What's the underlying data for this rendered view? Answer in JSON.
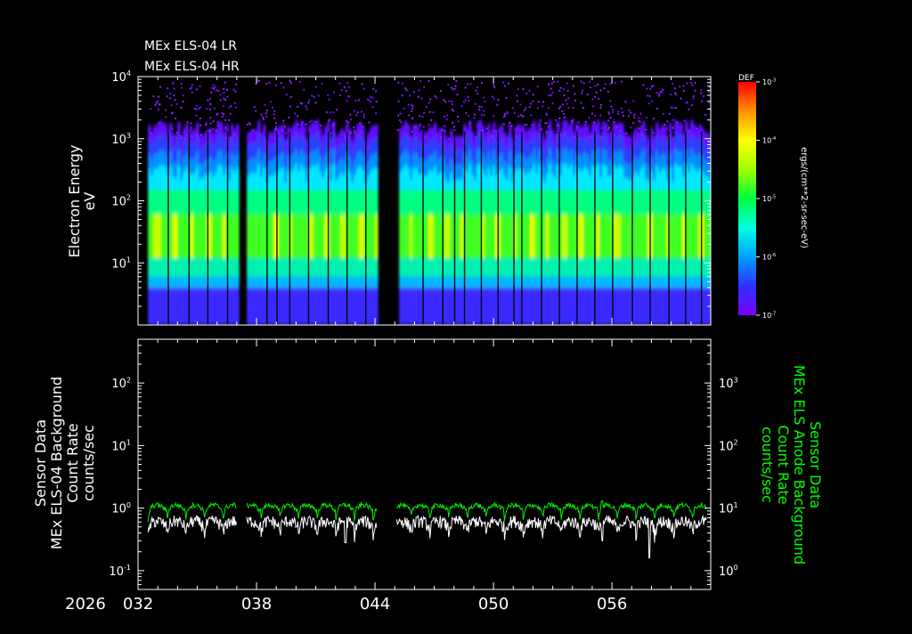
{
  "chart_data": [
    {
      "type": "heatmap",
      "title_lines": [
        "MEx ELS-04 LR",
        "MEx ELS-04 HR"
      ],
      "ylabel_lines": [
        "Electron Energy",
        "eV"
      ],
      "y_scale": "log",
      "ylim": [
        1,
        10000
      ],
      "y_ticks": [
        {
          "value": 10,
          "label": "10",
          "exp": "1"
        },
        {
          "value": 100,
          "label": "10",
          "exp": "2"
        },
        {
          "value": 1000,
          "label": "10",
          "exp": "3"
        },
        {
          "value": 10000,
          "label": "10",
          "exp": "4"
        }
      ],
      "x_range_doy": [
        32,
        61
      ],
      "data_gaps_doy": [
        [
          37.0,
          37.5
        ],
        [
          44.1,
          45.1
        ]
      ],
      "orbit_boundaries_doy": [
        33.5,
        34.55,
        35.5,
        36.5,
        38.5,
        39.0,
        39.65,
        40.6,
        41.6,
        42.55,
        43.5,
        44.15,
        46.4,
        47.4,
        48.0,
        48.5,
        49.35,
        50.2,
        51.0,
        51.4,
        52.4,
        53.3,
        54.2,
        55.1,
        56.0,
        57.0,
        57.9,
        58.85,
        59.7,
        60.5
      ],
      "colorbar": {
        "label": "DEF",
        "title": "ergs/(cm**2-sr-sec-eV)",
        "scale": "log",
        "range": [
          1e-07,
          0.001
        ],
        "ticks": [
          {
            "value": 0.001,
            "label": "10",
            "exp": "-3"
          },
          {
            "value": 0.0001,
            "label": "10",
            "exp": "-4"
          },
          {
            "value": 1e-05,
            "label": "10",
            "exp": "-5"
          },
          {
            "value": 1e-06,
            "label": "10",
            "exp": "-6"
          },
          {
            "value": 1e-07,
            "label": "10",
            "exp": "-7"
          }
        ],
        "colors": [
          "#7a00ff",
          "#3030ff",
          "#00a0ff",
          "#00ffe0",
          "#00ff40",
          "#a0ff00",
          "#ffff00",
          "#ff9000",
          "#ff0000"
        ]
      }
    },
    {
      "type": "line",
      "ylabel_left_lines": [
        "Sensor Data",
        "MEx ELS-04 Background",
        "Count Rate",
        "counts/sec"
      ],
      "ylabel_right_lines": [
        "Sensor Data",
        "MEx ELS Anode Background",
        "Count Rate",
        "counts/sec"
      ],
      "y_scale": "log",
      "ylim_left": [
        0.05,
        500
      ],
      "ylim_right": [
        0.5,
        5000
      ],
      "y_ticks_left": [
        {
          "value": 0.1,
          "label": "10",
          "exp": "-1"
        },
        {
          "value": 1,
          "label": "10",
          "exp": "0"
        },
        {
          "value": 10,
          "label": "10",
          "exp": "1"
        },
        {
          "value": 100,
          "label": "10",
          "exp": "2"
        }
      ],
      "y_ticks_right": [
        {
          "value": 1,
          "label": "10",
          "exp": "0"
        },
        {
          "value": 10,
          "label": "10",
          "exp": "1"
        },
        {
          "value": 100,
          "label": "10",
          "exp": "2"
        },
        {
          "value": 1000,
          "label": "10",
          "exp": "3"
        }
      ],
      "x_range_doy": [
        32,
        61
      ],
      "x_ticks": [
        {
          "value": 32,
          "label": "032"
        },
        {
          "value": 38,
          "label": "038"
        },
        {
          "value": 44,
          "label": "044"
        },
        {
          "value": 50,
          "label": "050"
        },
        {
          "value": 56,
          "label": "056"
        }
      ],
      "year_label": "2026",
      "series": [
        {
          "axis": "left",
          "color": "#ffffff",
          "level": 0.5,
          "segments": [
            [
              32.5,
              37.0
            ],
            [
              37.5,
              44.1
            ],
            [
              45.1,
              60.8
            ]
          ],
          "dips": [
            [
              42.5,
              0.28
            ],
            [
              57.9,
              0.16
            ],
            [
              55.5,
              0.3
            ]
          ]
        },
        {
          "axis": "right",
          "color": "#00ee00",
          "level": 9.0,
          "segments": [
            [
              32.5,
              37.0
            ],
            [
              37.5,
              44.1
            ],
            [
              45.1,
              60.8
            ]
          ],
          "peaks": [
            [
              55.5,
              13
            ]
          ]
        }
      ]
    }
  ]
}
